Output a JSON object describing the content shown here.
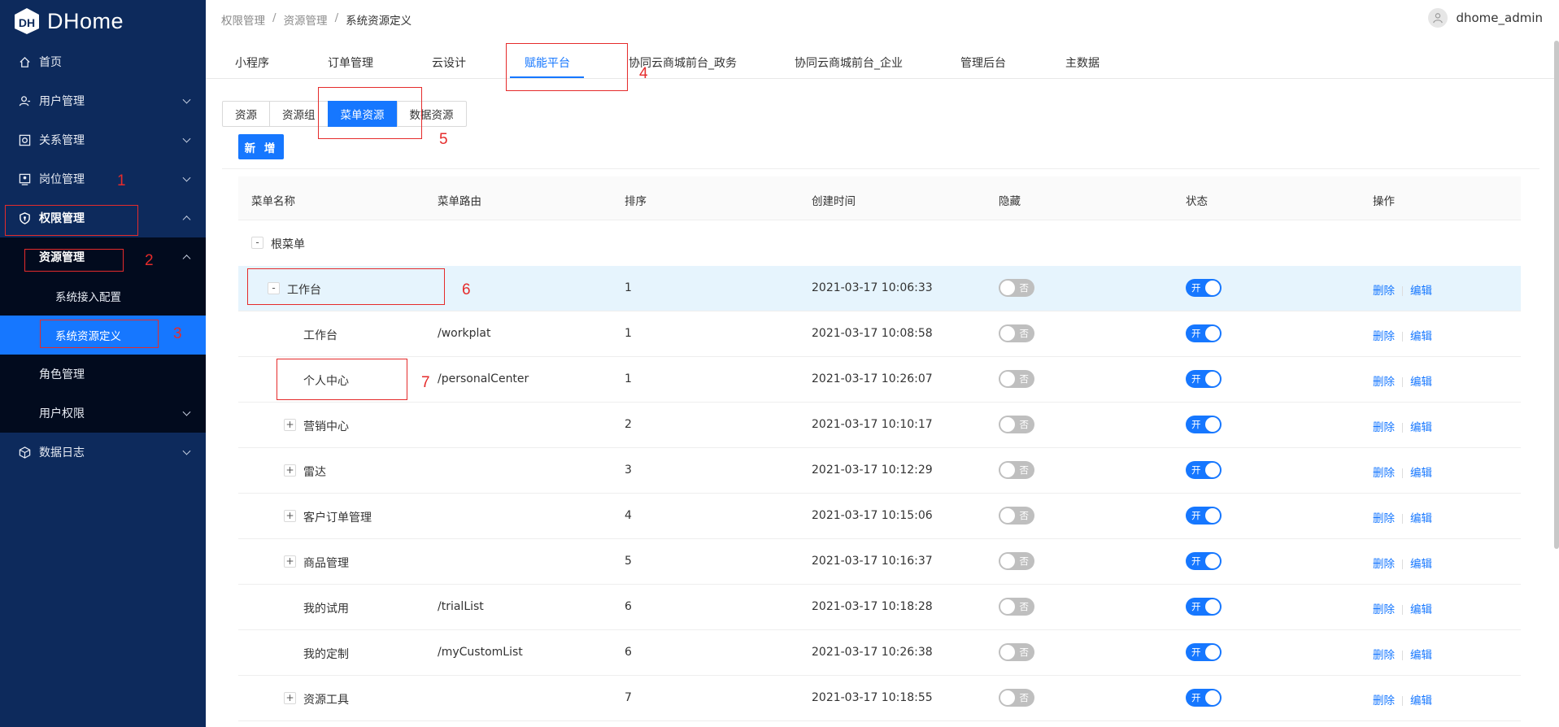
{
  "app": {
    "name": "DHome"
  },
  "sidebar": {
    "items": [
      {
        "label": "首页",
        "icon": "home-icon"
      },
      {
        "label": "用户管理",
        "icon": "user-icon"
      },
      {
        "label": "关系管理",
        "icon": "relation-icon"
      },
      {
        "label": "岗位管理",
        "icon": "post-icon"
      },
      {
        "label": "权限管理",
        "icon": "shield-icon"
      },
      {
        "label": "资源管理"
      },
      {
        "label": "系统接入配置"
      },
      {
        "label": "系统资源定义"
      },
      {
        "label": "角色管理"
      },
      {
        "label": "用户权限"
      },
      {
        "label": "数据日志",
        "icon": "log-icon"
      }
    ]
  },
  "breadcrumb": [
    "权限管理",
    "资源管理",
    "系统资源定义"
  ],
  "breadcrumb_sep": "/",
  "user": {
    "name": "dhome_admin"
  },
  "tabs": [
    "小程序",
    "订单管理",
    "云设计",
    "赋能平台",
    "协同云商城前台_政务",
    "协同云商城前台_企业",
    "管理后台",
    "主数据"
  ],
  "active_tab": "赋能平台",
  "segments": [
    "资源",
    "资源组",
    "菜单资源",
    "数据资源"
  ],
  "active_segment": "菜单资源",
  "add_button": "新 增",
  "table": {
    "headers": [
      "菜单名称",
      "菜单路由",
      "排序",
      "创建时间",
      "隐藏",
      "状态",
      "操作"
    ],
    "root": "根菜单",
    "rows": [
      {
        "name": "工作台",
        "route": "",
        "order": "1",
        "time": "2021-03-17 10:06:33"
      },
      {
        "name": "工作台",
        "route": "/workplat",
        "order": "1",
        "time": "2021-03-17 10:08:58"
      },
      {
        "name": "个人中心",
        "route": "/personalCenter",
        "order": "1",
        "time": "2021-03-17 10:26:07"
      },
      {
        "name": "营销中心",
        "route": "",
        "order": "2",
        "time": "2021-03-17 10:10:17"
      },
      {
        "name": "雷达",
        "route": "",
        "order": "3",
        "time": "2021-03-17 10:12:29"
      },
      {
        "name": "客户订单管理",
        "route": "",
        "order": "4",
        "time": "2021-03-17 10:15:06"
      },
      {
        "name": "商品管理",
        "route": "",
        "order": "5",
        "time": "2021-03-17 10:16:37"
      },
      {
        "name": "我的试用",
        "route": "/trialList",
        "order": "6",
        "time": "2021-03-17 10:18:28"
      },
      {
        "name": "我的定制",
        "route": "/myCustomList",
        "order": "6",
        "time": "2021-03-17 10:26:38"
      },
      {
        "name": "资源工具",
        "route": "",
        "order": "7",
        "time": "2021-03-17 10:18:55"
      }
    ],
    "hide_label": "否",
    "state_label": "开",
    "delete_label": "删除",
    "edit_label": "编辑",
    "collapse_symbol": "-",
    "expand_symbol": "+"
  },
  "annotations": [
    "1",
    "2",
    "3",
    "4",
    "5",
    "6",
    "7"
  ],
  "colors": {
    "sidebar": "#0d2a5c",
    "submenu": "#020b1e",
    "primary": "#1677ff",
    "annotation": "#e52b2b",
    "row_highlight": "#e6f4fd"
  }
}
